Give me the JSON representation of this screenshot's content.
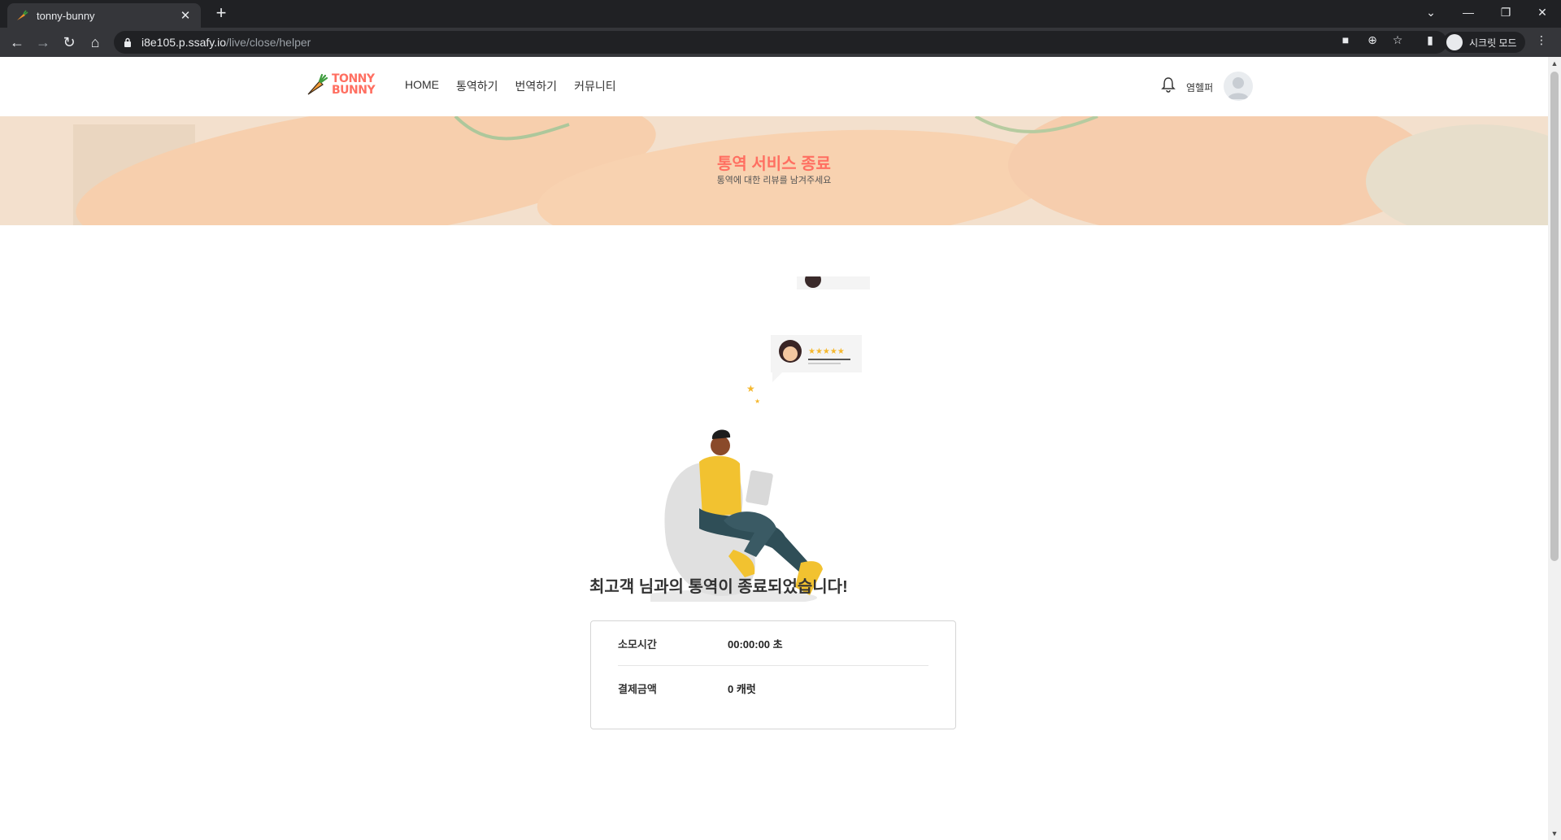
{
  "browser": {
    "tab_title": "tonny-bunny",
    "new_tab_label": "+",
    "url_host": "i8e105.p.ssafy.io",
    "url_path": "/live/close/helper",
    "incognito_label": "시크릿 모드"
  },
  "header": {
    "logo_line1": "TONNY",
    "logo_line2": "BUNNY",
    "nav": [
      "HOME",
      "통역하기",
      "번역하기",
      "커뮤니티"
    ],
    "username": "염헬퍼"
  },
  "banner": {
    "title": "통역 서비스 종료",
    "subtitle": "통역에 대한 리뷰를 남겨주세요"
  },
  "main": {
    "end_message": "최고객 님과의 통역이 종료되었습니다!",
    "summary": [
      {
        "label": "소모시간",
        "value": "00:00:00 초"
      },
      {
        "label": "결제금액",
        "value": "0 캐럿"
      }
    ]
  },
  "colors": {
    "accent": "#ff6f61",
    "browser_dark": "#202124",
    "browser_tab": "#35363a"
  }
}
